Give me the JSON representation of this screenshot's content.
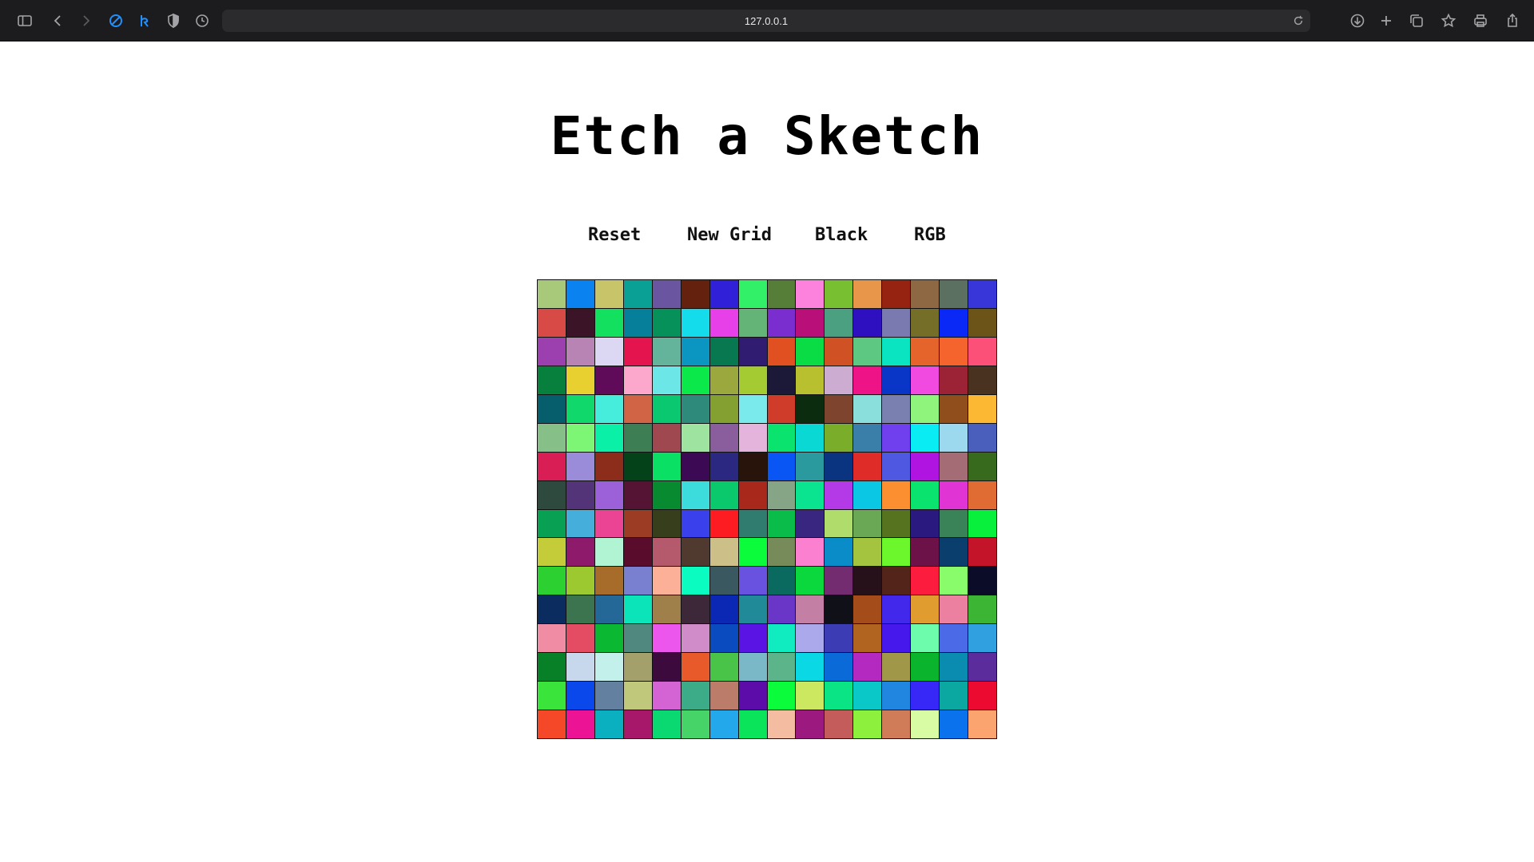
{
  "browser": {
    "url": "127.0.0.1",
    "icons": [
      "sidebar-icon",
      "back-icon",
      "forward-icon",
      "blocker-icon",
      "extension-icon",
      "shield-icon",
      "history-icon",
      "reload-icon",
      "download-icon",
      "new-tab-icon",
      "tabs-icon",
      "bookmark-icon",
      "print-icon",
      "share-icon"
    ]
  },
  "page": {
    "title": "Etch a Sketch"
  },
  "controls": {
    "reset": "Reset",
    "new_grid": "New Grid",
    "black": "Black",
    "rgb": "RGB"
  },
  "grid": {
    "size": 16,
    "colors": [
      [
        "#a8c87a",
        "#0a82f0",
        "#c8c46a",
        "#0aa096",
        "#6a56a0",
        "#64220e",
        "#3020d8",
        "#32f068",
        "#567e38",
        "#fc82de",
        "#78c032",
        "#e8964a",
        "#962212",
        "#8e6842",
        "#5c7062",
        "#3836d8"
      ],
      [
        "#d84a46",
        "#3c1428",
        "#14e060",
        "#06809a",
        "#06905a",
        "#14dcea",
        "#e840e8",
        "#64b478",
        "#7a2ed0",
        "#b81078",
        "#4aa080",
        "#2e10c0",
        "#7a7ab0",
        "#746e28",
        "#0a28f6",
        "#6c5418"
      ],
      [
        "#9c40b0",
        "#b884b4",
        "#dcd8f4",
        "#e4144e",
        "#64b49c",
        "#0a96c0",
        "#087850",
        "#301c70",
        "#e05020",
        "#0adc46",
        "#d05224",
        "#5cc882",
        "#0ae4c0",
        "#e4642c",
        "#f4642c",
        "#fc5078"
      ],
      [
        "#06803c",
        "#e8d030",
        "#600a5a",
        "#fca8cc",
        "#6ce6e6",
        "#0ae84a",
        "#9aa83e",
        "#a4cc32",
        "#1c1838",
        "#b8c030",
        "#ccacd0",
        "#ee1488",
        "#0a36c8",
        "#f04ae0",
        "#9c2236",
        "#4a3220"
      ],
      [
        "#065e6c",
        "#10d86a",
        "#46ecdc",
        "#d06444",
        "#0ac870",
        "#2e8a7a",
        "#84a030",
        "#7aeaec",
        "#d03c2a",
        "#0c2c10",
        "#7e442e",
        "#8adedc",
        "#7a80b0",
        "#8ef47c",
        "#904e1c",
        "#fcb832"
      ],
      [
        "#86c088",
        "#7cf674",
        "#0af0a6",
        "#3e7e54",
        "#a04850",
        "#9ee4a0",
        "#8a5e9c",
        "#e4b4dc",
        "#0ae46e",
        "#0ad8d4",
        "#7aae2a",
        "#3a7eaa",
        "#7040ee",
        "#0aecf4",
        "#9cd8ee",
        "#4a5ebc"
      ],
      [
        "#d81e54",
        "#9a8cd8",
        "#8c2c1a",
        "#04421a",
        "#0ae064",
        "#3c0a54",
        "#2a2880",
        "#28140a",
        "#0a56f4",
        "#2a9a9e",
        "#0a3480",
        "#e02c28",
        "#4e58e0",
        "#b014e0",
        "#a46c74",
        "#386a1e"
      ],
      [
        "#2e4a3e",
        "#543478",
        "#9c60d8",
        "#561434",
        "#088a30",
        "#3cdcdc",
        "#0ac86c",
        "#a8281c",
        "#86a486",
        "#0ae490",
        "#b43ae8",
        "#0ac8e4",
        "#fc9030",
        "#0ae46e",
        "#e034d4",
        "#e06c34"
      ],
      [
        "#08a052",
        "#46aeda",
        "#ec4494",
        "#9c3c24",
        "#363e1c",
        "#3a40ec",
        "#fc1c22",
        "#307c6e",
        "#0abc4a",
        "#382680",
        "#b0dc6c",
        "#6aa856",
        "#567420",
        "#2a1a80",
        "#3a8258",
        "#08f03c"
      ],
      [
        "#c4cc3a",
        "#8e1a6c",
        "#b0f4d4",
        "#5a0c2c",
        "#b45a6c",
        "#503a30",
        "#ccc088",
        "#0afc3a",
        "#768a5a",
        "#fc80d0",
        "#0a8cc8",
        "#a4c440",
        "#6cf62c",
        "#6c1248",
        "#0a3e6c",
        "#c4142a"
      ],
      [
        "#2cd030",
        "#9cc830",
        "#a86c2a",
        "#7a80d0",
        "#fcb098",
        "#0afcc0",
        "#3a5860",
        "#6a52e0",
        "#0a6a60",
        "#0ad83c",
        "#742c70",
        "#26101a",
        "#52241a",
        "#fc1c3e",
        "#88fc6a",
        "#0a0c28"
      ],
      [
        "#0a2c5e",
        "#3c7450",
        "#246898",
        "#0ae4b8",
        "#a0804a",
        "#3c2838",
        "#0a28b4",
        "#208a98",
        "#6a36c8",
        "#c480a4",
        "#101018",
        "#a44c1a",
        "#4228ea",
        "#e09c2e",
        "#ec80a0",
        "#3cb434"
      ],
      [
        "#f08ca4",
        "#e44c64",
        "#0ab832",
        "#508880",
        "#ec56ec",
        "#d08cc8",
        "#0a4cc0",
        "#5a14e4",
        "#10ecc0",
        "#aca8ec",
        "#3c3cb4",
        "#b06420",
        "#4618ec",
        "#6cfcac",
        "#4a6ae8",
        "#30a0e0"
      ],
      [
        "#088028",
        "#c8d8ec",
        "#c4f0ec",
        "#a4a06c",
        "#3c0a3c",
        "#e85a2a",
        "#4ac448",
        "#7ab8c8",
        "#5cb48a",
        "#0ad8e4",
        "#0a6ad8",
        "#b42ac0",
        "#a09848",
        "#0ab42c",
        "#0a8cb0",
        "#5a2c9c"
      ],
      [
        "#3ae43a",
        "#0a48ec",
        "#6480a0",
        "#c0c87c",
        "#d464d4",
        "#3cac88",
        "#bc7c6a",
        "#5c0ca8",
        "#0afc3a",
        "#cce860",
        "#0ae484",
        "#0ac8c8",
        "#2086e0",
        "#3828f8",
        "#0aa8a0",
        "#ec0a30"
      ],
      [
        "#f44828",
        "#ec1494",
        "#0ab0c0",
        "#a8186a",
        "#0ad870",
        "#46d468",
        "#24a8ec",
        "#0ae45a",
        "#f4bca0",
        "#9c1a80",
        "#c45c5c",
        "#8cf03c",
        "#d07c58",
        "#d8fca4",
        "#0a72ec",
        "#fca470"
      ]
    ]
  }
}
